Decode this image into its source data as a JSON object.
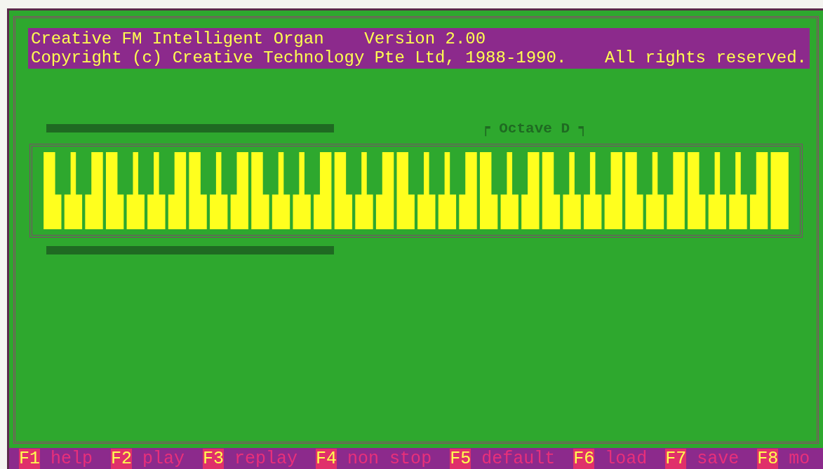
{
  "header": {
    "title": "Creative FM Intelligent Organ",
    "version": "Version 2.00",
    "copyright": "Copyright (c) Creative Technology Pte Ltd, 1988-1990.",
    "rights": "All rights reserved."
  },
  "octave_label": "┍ Octave D ┑",
  "function_keys": [
    {
      "key": "F1",
      "label": "help"
    },
    {
      "key": "F2",
      "label": "play"
    },
    {
      "key": "F3",
      "label": "replay"
    },
    {
      "key": "F4",
      "label": "non stop"
    },
    {
      "key": "F5",
      "label": "default"
    },
    {
      "key": "F6",
      "label": "load"
    },
    {
      "key": "F7",
      "label": "save"
    },
    {
      "key": "F8",
      "label": "mo"
    }
  ]
}
